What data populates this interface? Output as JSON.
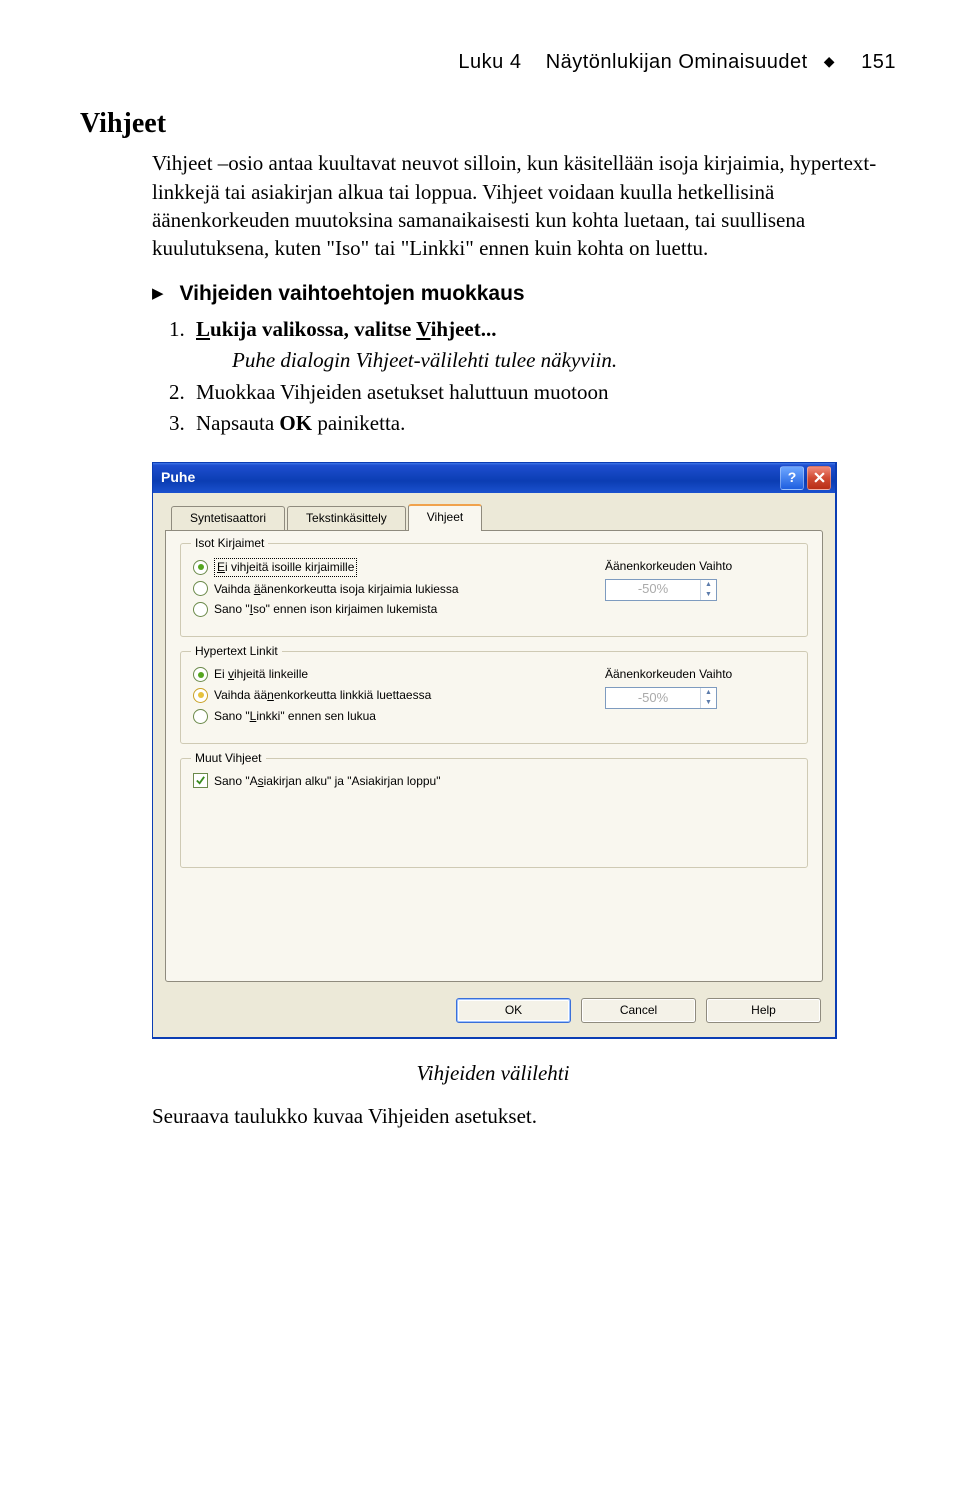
{
  "header": {
    "chapter": "Luku 4",
    "chapter_title": "Näytönlukijan Ominaisuudet",
    "diamond": "◆",
    "page_no": "151"
  },
  "section": {
    "title": "Vihjeet",
    "para1": "Vihjeet –osio antaa kuultavat neuvot silloin, kun käsitellään isoja kirjaimia, hypertext-linkkejä tai asiakirjan alkua tai loppua. Vihjeet voidaan kuulla hetkellisinä äänenkorkeuden muutoksina samanaikaisesti kun kohta luetaan, tai suullisena kuulutuksena, kuten \"Iso\" tai \"Linkki\" ennen kuin kohta on luettu.",
    "subtitle_marker": "▶",
    "subtitle": "Vihjeiden vaihtoehtojen muokkaus",
    "step1_a": "L",
    "step1_b": "ukija valikossa, valitse ",
    "step1_c": "V",
    "step1_d": "ihjeet...",
    "step1_sub": "Puhe dialogin Vihjeet-välilehti tulee näkyviin.",
    "step2": "Muokkaa Vihjeiden asetukset haluttuun muotoon",
    "step3_a": "Napsauta ",
    "step3_b": "OK",
    "step3_c": " painiketta."
  },
  "dialog": {
    "title": "Puhe",
    "help_symbol": "?",
    "tabs": {
      "t1": "Syntetisaattori",
      "t2": "Tekstinkäsittely",
      "t3": "Vihjeet"
    },
    "group1": {
      "title": "Isot Kirjaimet",
      "r1_a": "E",
      "r1_b": "i vihjeitä isoille kirjaimille",
      "r2_a": "Vaihda ",
      "r2_b": "ä",
      "r2_c": "änenkorkeutta isoja kirjaimia lukiessa",
      "r3_a": "Sano \"",
      "r3_b": "I",
      "r3_c": "so\" ennen ison kirjaimen lukemista",
      "pitch_label": "Äänenkorkeuden Vaihto",
      "pitch_value": "-50%"
    },
    "group2": {
      "title": "Hypertext Linkit",
      "r1_a": "Ei ",
      "r1_b": "v",
      "r1_c": "ihjeitä linkeille",
      "r2_a": "Vaihda ää",
      "r2_b": "n",
      "r2_c": "enkorkeutta linkkiä luettaessa",
      "r3_a": "Sano \"",
      "r3_b": "L",
      "r3_c": "inkki\" ennen sen lukua",
      "pitch_label": "Äänenkorkeuden Vaihto",
      "pitch_value": "-50%"
    },
    "group3": {
      "title": "Muut Vihjeet",
      "c1_a": "Sano \"A",
      "c1_b": "s",
      "c1_c": "iakirjan alku\" ja \"Asiakirjan loppu\""
    },
    "buttons": {
      "ok": "OK",
      "cancel": "Cancel",
      "help": "Help"
    }
  },
  "caption": "Vihjeiden välilehti",
  "trailer": "Seuraava taulukko kuvaa Vihjeiden asetukset."
}
